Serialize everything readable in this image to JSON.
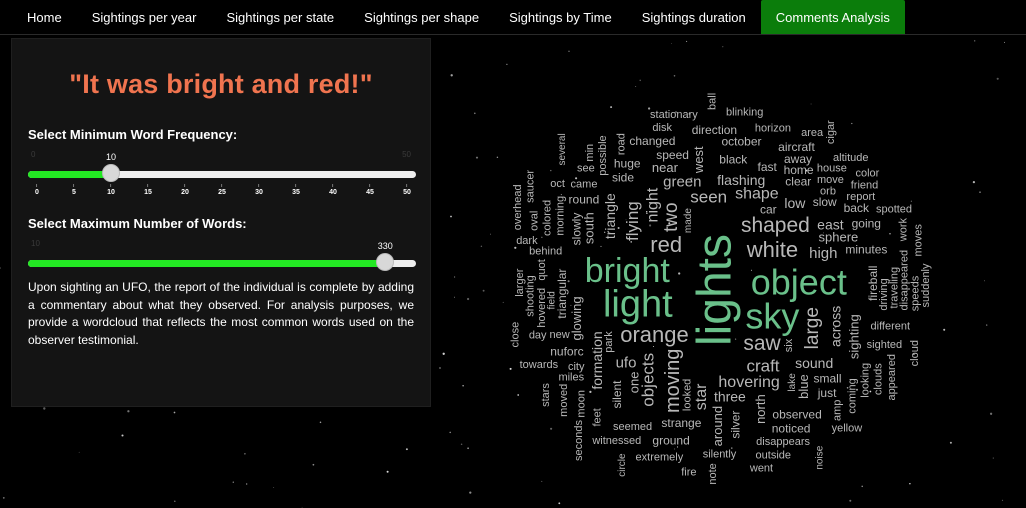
{
  "nav": {
    "tabs": [
      {
        "label": "Home",
        "active": false
      },
      {
        "label": "Sightings per year",
        "active": false
      },
      {
        "label": "Sightings per state",
        "active": false
      },
      {
        "label": "Sightings per shape",
        "active": false
      },
      {
        "label": "Sightings by Time",
        "active": false
      },
      {
        "label": "Sightings duration",
        "active": false
      },
      {
        "label": "Comments Analysis",
        "active": true
      }
    ]
  },
  "panel": {
    "quote": "\"It was bright and red!\"",
    "min_freq": {
      "label": "Select Minimum Word Frequency:",
      "min": 0,
      "max": 50,
      "value": 10,
      "min_label": "0",
      "max_label": "50",
      "value_label": "10",
      "ticks": [
        "0",
        "5",
        "10",
        "15",
        "20",
        "25",
        "30",
        "35",
        "40",
        "45",
        "50"
      ]
    },
    "max_words": {
      "label": "Select Maximum Number of Words:",
      "min": 10,
      "max": 350,
      "value": 330,
      "min_label": "10",
      "value_label": "330"
    },
    "description": "Upon sighting an UFO, the report of the individual is complete by adding a commentary about what they observed. For analysis purposes, we provide a wordcloud that reflects the most common words used on the observer testimonial."
  },
  "colors": {
    "accent_quote": "#f0744f",
    "active_tab": "#0b7d0b",
    "slider_fill": "#23e823",
    "cloud_green": "#6ac08a",
    "cloud_gray": "#b8b8b8"
  },
  "wordcloud": {
    "words": [
      {
        "text": "lights",
        "size": 48,
        "color": "green",
        "vertical": true
      },
      {
        "text": "light",
        "size": 38,
        "color": "green",
        "vertical": false
      },
      {
        "text": "object",
        "size": 36,
        "color": "green",
        "vertical": false
      },
      {
        "text": "sky",
        "size": 36,
        "color": "green",
        "vertical": false
      },
      {
        "text": "bright",
        "size": 34,
        "color": "green",
        "vertical": false
      },
      {
        "text": "orange",
        "size": 22,
        "color": "gray",
        "vertical": false
      },
      {
        "text": "shaped",
        "size": 21,
        "color": "gray",
        "vertical": false
      },
      {
        "text": "white",
        "size": 22,
        "color": "gray",
        "vertical": false
      },
      {
        "text": "red",
        "size": 22,
        "color": "gray",
        "vertical": false
      },
      {
        "text": "saw",
        "size": 21,
        "color": "gray",
        "vertical": false
      },
      {
        "text": "moving",
        "size": 20,
        "color": "gray",
        "vertical": true
      },
      {
        "text": "two",
        "size": 19,
        "color": "gray",
        "vertical": true
      },
      {
        "text": "large",
        "size": 19,
        "color": "gray",
        "vertical": true
      },
      {
        "text": "flying",
        "size": 17,
        "color": "gray",
        "vertical": true
      },
      {
        "text": "craft",
        "size": 17,
        "color": "gray",
        "vertical": false
      },
      {
        "text": "seen",
        "size": 17,
        "color": "gray",
        "vertical": false
      },
      {
        "text": "hovering",
        "size": 16,
        "color": "gray",
        "vertical": false
      },
      {
        "text": "objects",
        "size": 17,
        "color": "gray",
        "vertical": true
      },
      {
        "text": "shape",
        "size": 16,
        "color": "gray",
        "vertical": false
      },
      {
        "text": "night",
        "size": 16,
        "color": "gray",
        "vertical": true
      },
      {
        "text": "star",
        "size": 16,
        "color": "gray",
        "vertical": true
      },
      {
        "text": "three",
        "size": 14,
        "color": "gray",
        "vertical": false
      },
      {
        "text": "high",
        "size": 15,
        "color": "gray",
        "vertical": false
      },
      {
        "text": "ufo",
        "size": 15,
        "color": "gray",
        "vertical": false
      },
      {
        "text": "green",
        "size": 15,
        "color": "gray",
        "vertical": false
      },
      {
        "text": "flashing",
        "size": 14,
        "color": "gray",
        "vertical": false
      },
      {
        "text": "sound",
        "size": 14,
        "color": "gray",
        "vertical": false
      },
      {
        "text": "glowing",
        "size": 13,
        "color": "gray",
        "vertical": true
      },
      {
        "text": "blue",
        "size": 13,
        "color": "gray",
        "vertical": true
      },
      {
        "text": "silver",
        "size": 12,
        "color": "gray",
        "vertical": true
      },
      {
        "text": "one",
        "size": 13,
        "color": "gray",
        "vertical": true
      },
      {
        "text": "north",
        "size": 13,
        "color": "gray",
        "vertical": true
      },
      {
        "text": "triangle",
        "size": 14,
        "color": "gray",
        "vertical": true
      },
      {
        "text": "south",
        "size": 13,
        "color": "gray",
        "vertical": true
      },
      {
        "text": "sighting",
        "size": 13,
        "color": "gray",
        "vertical": true
      },
      {
        "text": "across",
        "size": 14,
        "color": "gray",
        "vertical": true
      },
      {
        "text": "triangular",
        "size": 12,
        "color": "gray",
        "vertical": true
      },
      {
        "text": "formation",
        "size": 14,
        "color": "gray",
        "vertical": true
      },
      {
        "text": "around",
        "size": 13,
        "color": "gray",
        "vertical": true
      },
      {
        "text": "low",
        "size": 14,
        "color": "gray",
        "vertical": false
      },
      {
        "text": "east",
        "size": 14,
        "color": "gray",
        "vertical": false
      },
      {
        "text": "west",
        "size": 13,
        "color": "gray",
        "vertical": true
      },
      {
        "text": "sphere",
        "size": 13,
        "color": "gray",
        "vertical": false
      },
      {
        "text": "black",
        "size": 12,
        "color": "gray",
        "vertical": false
      },
      {
        "text": "silent",
        "size": 12,
        "color": "gray",
        "vertical": true
      },
      {
        "text": "looked",
        "size": 11,
        "color": "gray",
        "vertical": true
      },
      {
        "text": "near",
        "size": 13,
        "color": "gray",
        "vertical": false
      },
      {
        "text": "fast",
        "size": 12,
        "color": "gray",
        "vertical": false
      },
      {
        "text": "clear",
        "size": 12,
        "color": "gray",
        "vertical": false
      },
      {
        "text": "slow",
        "size": 12,
        "color": "gray",
        "vertical": false
      },
      {
        "text": "small",
        "size": 12,
        "color": "gray",
        "vertical": false
      },
      {
        "text": "strange",
        "size": 12,
        "color": "gray",
        "vertical": false
      },
      {
        "text": "car",
        "size": 12,
        "color": "gray",
        "vertical": false
      },
      {
        "text": "slowly",
        "size": 12,
        "color": "gray",
        "vertical": true
      },
      {
        "text": "six",
        "size": 11,
        "color": "gray",
        "vertical": true
      },
      {
        "text": "minutes",
        "size": 12,
        "color": "gray",
        "vertical": false
      },
      {
        "text": "observed",
        "size": 12,
        "color": "gray",
        "vertical": false
      },
      {
        "text": "side",
        "size": 12,
        "color": "gray",
        "vertical": false
      },
      {
        "text": "speed",
        "size": 12,
        "color": "gray",
        "vertical": false
      },
      {
        "text": "fireball",
        "size": 12,
        "color": "gray",
        "vertical": true
      },
      {
        "text": "nuforc",
        "size": 12,
        "color": "gray",
        "vertical": false
      },
      {
        "text": "home",
        "size": 12,
        "color": "gray",
        "vertical": false
      },
      {
        "text": "october",
        "size": 12,
        "color": "gray",
        "vertical": false
      },
      {
        "text": "round",
        "size": 12,
        "color": "gray",
        "vertical": false
      },
      {
        "text": "just",
        "size": 12,
        "color": "gray",
        "vertical": false
      },
      {
        "text": "orb",
        "size": 11,
        "color": "gray",
        "vertical": false
      },
      {
        "text": "huge",
        "size": 12,
        "color": "gray",
        "vertical": false
      },
      {
        "text": "noticed",
        "size": 12,
        "color": "gray",
        "vertical": false
      },
      {
        "text": "away",
        "size": 12,
        "color": "gray",
        "vertical": false
      },
      {
        "text": "city",
        "size": 11,
        "color": "gray",
        "vertical": false
      },
      {
        "text": "back",
        "size": 12,
        "color": "gray",
        "vertical": false
      },
      {
        "text": "going",
        "size": 12,
        "color": "gray",
        "vertical": false
      },
      {
        "text": "ground",
        "size": 12,
        "color": "gray",
        "vertical": false
      },
      {
        "text": "changed",
        "size": 12,
        "color": "gray",
        "vertical": false
      },
      {
        "text": "direction",
        "size": 12,
        "color": "gray",
        "vertical": false
      },
      {
        "text": "different",
        "size": 11,
        "color": "gray",
        "vertical": false
      },
      {
        "text": "disappears",
        "size": 11,
        "color": "gray",
        "vertical": false
      },
      {
        "text": "silently",
        "size": 11,
        "color": "gray",
        "vertical": false
      },
      {
        "text": "seemed",
        "size": 11,
        "color": "gray",
        "vertical": false
      },
      {
        "text": "aircraft",
        "size": 12,
        "color": "gray",
        "vertical": false
      },
      {
        "text": "behind",
        "size": 11,
        "color": "gray",
        "vertical": false
      },
      {
        "text": "sighted",
        "size": 11,
        "color": "gray",
        "vertical": false
      },
      {
        "text": "driving",
        "size": 11,
        "color": "gray",
        "vertical": true
      },
      {
        "text": "hovered",
        "size": 11,
        "color": "gray",
        "vertical": true
      },
      {
        "text": "miles",
        "size": 11,
        "color": "gray",
        "vertical": false
      },
      {
        "text": "move",
        "size": 11,
        "color": "gray",
        "vertical": false
      },
      {
        "text": "morning",
        "size": 11,
        "color": "gray",
        "vertical": true
      },
      {
        "text": "traveling",
        "size": 11,
        "color": "gray",
        "vertical": true
      },
      {
        "text": "looking",
        "size": 11,
        "color": "gray",
        "vertical": true
      },
      {
        "text": "coming",
        "size": 11,
        "color": "gray",
        "vertical": true
      },
      {
        "text": "shooting",
        "size": 11,
        "color": "gray",
        "vertical": true
      },
      {
        "text": "colored",
        "size": 11,
        "color": "gray",
        "vertical": true
      },
      {
        "text": "possible",
        "size": 11,
        "color": "gray",
        "vertical": true
      },
      {
        "text": "park",
        "size": 11,
        "color": "gray",
        "vertical": true
      },
      {
        "text": "disappeared",
        "size": 11,
        "color": "gray",
        "vertical": true
      },
      {
        "text": "quot",
        "size": 11,
        "color": "gray",
        "vertical": true
      },
      {
        "text": "feet",
        "size": 11,
        "color": "gray",
        "vertical": true
      },
      {
        "text": "moon",
        "size": 11,
        "color": "gray",
        "vertical": true
      },
      {
        "text": "came",
        "size": 11,
        "color": "gray",
        "vertical": false
      },
      {
        "text": "new",
        "size": 11,
        "color": "gray",
        "vertical": false
      },
      {
        "text": "report",
        "size": 11,
        "color": "gray",
        "vertical": false
      },
      {
        "text": "extremely",
        "size": 11,
        "color": "gray",
        "vertical": false
      },
      {
        "text": "house",
        "size": 11,
        "color": "gray",
        "vertical": false
      },
      {
        "text": "horizon",
        "size": 11,
        "color": "gray",
        "vertical": false
      },
      {
        "text": "outside",
        "size": 11,
        "color": "gray",
        "vertical": false
      },
      {
        "text": "road",
        "size": 11,
        "color": "gray",
        "vertical": true
      },
      {
        "text": "clouds",
        "size": 11,
        "color": "gray",
        "vertical": true
      },
      {
        "text": "witnessed",
        "size": 11,
        "color": "gray",
        "vertical": false
      },
      {
        "text": "day",
        "size": 11,
        "color": "gray",
        "vertical": false
      },
      {
        "text": "disk",
        "size": 11,
        "color": "gray",
        "vertical": false
      },
      {
        "text": "see",
        "size": 11,
        "color": "gray",
        "vertical": false
      },
      {
        "text": "stationary",
        "size": 11,
        "color": "gray",
        "vertical": false
      },
      {
        "text": "blinking",
        "size": 11,
        "color": "gray",
        "vertical": false
      },
      {
        "text": "made",
        "size": 10,
        "color": "gray",
        "vertical": true
      },
      {
        "text": "towards",
        "size": 11,
        "color": "gray",
        "vertical": false
      },
      {
        "text": "altitude",
        "size": 11,
        "color": "gray",
        "vertical": false
      },
      {
        "text": "friend",
        "size": 11,
        "color": "gray",
        "vertical": false
      },
      {
        "text": "spotted",
        "size": 11,
        "color": "gray",
        "vertical": false
      },
      {
        "text": "yellow",
        "size": 11,
        "color": "gray",
        "vertical": false
      },
      {
        "text": "larger",
        "size": 11,
        "color": "gray",
        "vertical": true
      },
      {
        "text": "moved",
        "size": 11,
        "color": "gray",
        "vertical": true
      },
      {
        "text": "oval",
        "size": 11,
        "color": "gray",
        "vertical": true
      },
      {
        "text": "amp",
        "size": 11,
        "color": "gray",
        "vertical": true
      },
      {
        "text": "dark",
        "size": 11,
        "color": "gray",
        "vertical": false
      },
      {
        "text": "field",
        "size": 10,
        "color": "gray",
        "vertical": true
      },
      {
        "text": "area",
        "size": 11,
        "color": "gray",
        "vertical": false
      },
      {
        "text": "oct",
        "size": 11,
        "color": "gray",
        "vertical": false
      },
      {
        "text": "speeds",
        "size": 11,
        "color": "gray",
        "vertical": true
      },
      {
        "text": "appeared",
        "size": 11,
        "color": "gray",
        "vertical": true
      },
      {
        "text": "stars",
        "size": 11,
        "color": "gray",
        "vertical": true
      },
      {
        "text": "close",
        "size": 11,
        "color": "gray",
        "vertical": true
      },
      {
        "text": "cigar",
        "size": 11,
        "color": "gray",
        "vertical": true
      },
      {
        "text": "suddenly",
        "size": 11,
        "color": "gray",
        "vertical": true
      },
      {
        "text": "overhead",
        "size": 11,
        "color": "gray",
        "vertical": true
      },
      {
        "text": "work",
        "size": 11,
        "color": "gray",
        "vertical": true
      },
      {
        "text": "moves",
        "size": 11,
        "color": "gray",
        "vertical": true
      },
      {
        "text": "color",
        "size": 11,
        "color": "gray",
        "vertical": false
      },
      {
        "text": "went",
        "size": 11,
        "color": "gray",
        "vertical": false
      },
      {
        "text": "cloud",
        "size": 11,
        "color": "gray",
        "vertical": true
      },
      {
        "text": "seconds",
        "size": 11,
        "color": "gray",
        "vertical": true
      },
      {
        "text": "note",
        "size": 11,
        "color": "gray",
        "vertical": true
      },
      {
        "text": "lake",
        "size": 10,
        "color": "gray",
        "vertical": true
      },
      {
        "text": "noise",
        "size": 10,
        "color": "gray",
        "vertical": true
      },
      {
        "text": "circle",
        "size": 10,
        "color": "gray",
        "vertical": true
      },
      {
        "text": "several",
        "size": 10,
        "color": "gray",
        "vertical": true
      },
      {
        "text": "fire",
        "size": 11,
        "color": "gray",
        "vertical": false
      },
      {
        "text": "ball",
        "size": 11,
        "color": "gray",
        "vertical": true
      },
      {
        "text": "min",
        "size": 11,
        "color": "gray",
        "vertical": true
      },
      {
        "text": "saucer",
        "size": 11,
        "color": "gray",
        "vertical": true
      }
    ]
  }
}
